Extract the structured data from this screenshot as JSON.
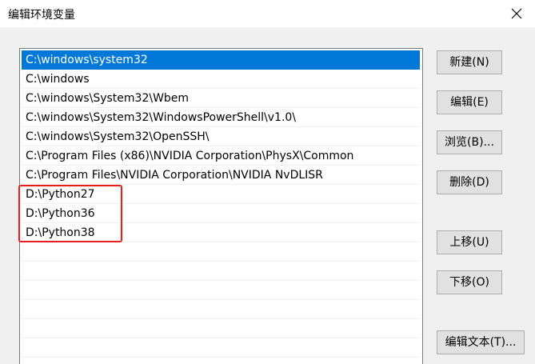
{
  "window": {
    "title": "编辑环境变量"
  },
  "paths": [
    "C:\\windows\\system32",
    "C:\\windows",
    "C:\\windows\\System32\\Wbem",
    "C:\\windows\\System32\\WindowsPowerShell\\v1.0\\",
    "C:\\windows\\System32\\OpenSSH\\",
    "C:\\Program Files (x86)\\NVIDIA Corporation\\PhysX\\Common",
    "C:\\Program Files\\NVIDIA Corporation\\NVIDIA NvDLISR",
    "D:\\Python27",
    "D:\\Python36",
    "D:\\Python38"
  ],
  "selected_index": 0,
  "buttons": {
    "new": "新建(N)",
    "edit": "编辑(E)",
    "browse": "浏览(B)...",
    "delete": "删除(D)",
    "move_up": "上移(U)",
    "move_down": "下移(O)",
    "edit_text": "编辑文本(T)..."
  },
  "colors": {
    "selection": "#0078d7",
    "highlight_border": "#e81e1e"
  },
  "icons": {
    "close": "close-icon"
  }
}
